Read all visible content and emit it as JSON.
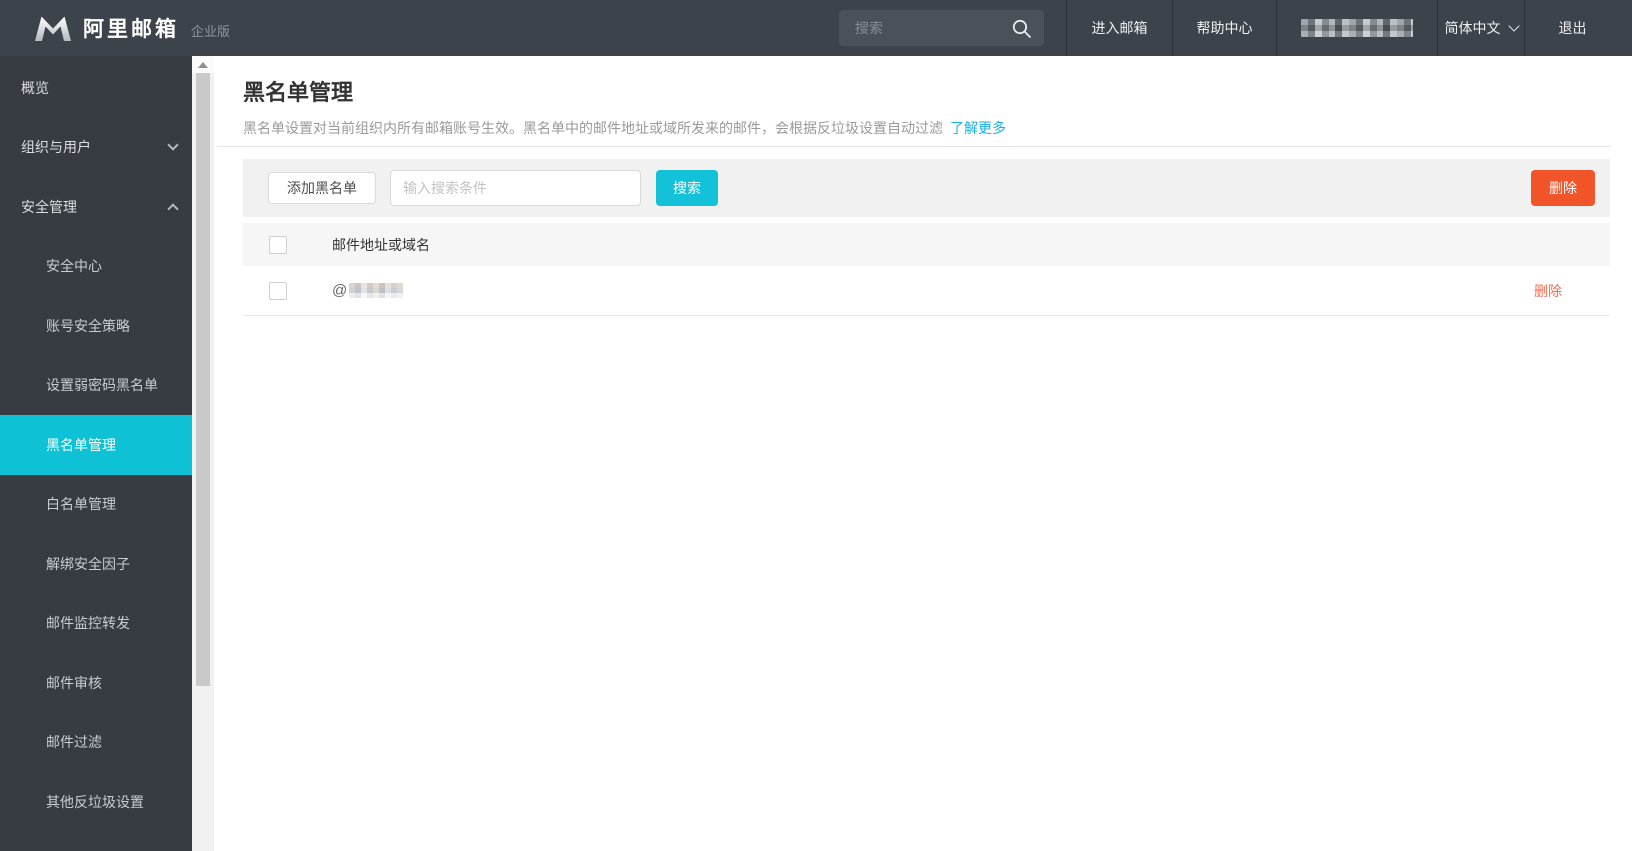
{
  "topbar": {
    "brand_name": "阿里邮箱",
    "brand_edition": "企业版",
    "search_placeholder": "搜索",
    "enter_mail": "进入邮箱",
    "help_center": "帮助中心",
    "user_account_redacted": true,
    "language": "简体中文",
    "logout": "退出"
  },
  "sidebar": {
    "items": [
      {
        "label": "概览",
        "level": 1
      },
      {
        "label": "组织与用户",
        "level": 1,
        "chevron": "down"
      },
      {
        "label": "安全管理",
        "level": 1,
        "chevron": "up"
      },
      {
        "label": "安全中心",
        "level": 2
      },
      {
        "label": "账号安全策略",
        "level": 2
      },
      {
        "label": "设置弱密码黑名单",
        "level": 2
      },
      {
        "label": "黑名单管理",
        "level": 2,
        "selected": true
      },
      {
        "label": "白名单管理",
        "level": 2
      },
      {
        "label": "解绑安全因子",
        "level": 2
      },
      {
        "label": "邮件监控转发",
        "level": 2
      },
      {
        "label": "邮件审核",
        "level": 2
      },
      {
        "label": "邮件过滤",
        "level": 2
      },
      {
        "label": "其他反垃圾设置",
        "level": 2
      }
    ]
  },
  "main": {
    "title": "黑名单管理",
    "description": "黑名单设置对当前组织内所有邮箱账号生效。黑名单中的邮件地址或域所发来的邮件，会根据反垃圾设置自动过滤",
    "learn_more": "了解更多",
    "toolbar": {
      "add_button": "添加黑名单",
      "search_placeholder": "输入搜索条件",
      "search_button": "搜索",
      "delete_button": "删除"
    },
    "table": {
      "columns": [
        "邮件地址或域名"
      ],
      "rows": [
        {
          "address_prefix": "@",
          "domain_redacted": true,
          "action": "删除"
        }
      ]
    }
  },
  "colors": {
    "accent_cyan": "#13c2d8",
    "sidebar_selected": "#0fc1d5",
    "link_blue": "#1ab1e0",
    "danger_orange": "#f2542a",
    "row_delete_link": "#f56c4e",
    "topbar_bg": "#3d434a",
    "sidebar_bg": "#363c42"
  }
}
